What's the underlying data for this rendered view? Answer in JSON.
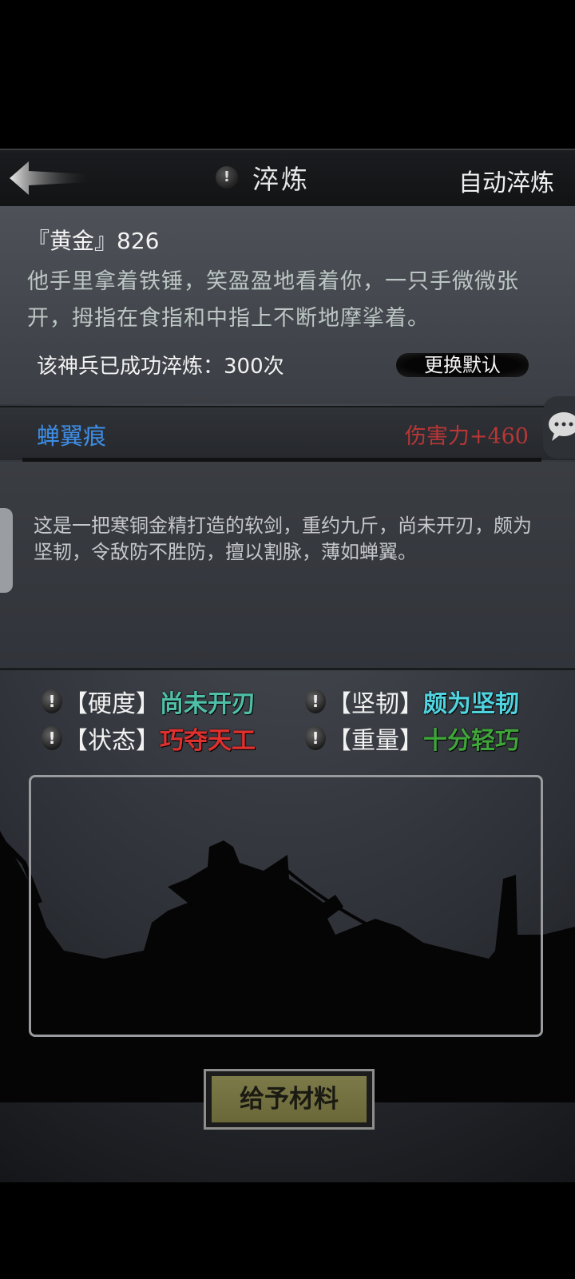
{
  "header": {
    "title": "淬炼",
    "info_icon": "!",
    "auto_label": "自动淬炼",
    "back_icon": "arrow-left-icon"
  },
  "item": {
    "name": "『黄金』826",
    "description": "他手里拿着铁锤，笑盈盈地看着你，一只手微微张开，拇指在食指和中指上不断地摩挲着。",
    "count_text": "该神兵已成功淬炼：300次",
    "default_button": "更换默认"
  },
  "weapon": {
    "name": "蝉翼痕",
    "damage": "伤害力+460",
    "lore": "这是一把寒铜金精打造的软剑，重约九斤，尚未开刃，颇为坚韧，令敌防不胜防，擅以割脉，薄如蝉翼。"
  },
  "stats": [
    {
      "label": "【硬度】",
      "value": "尚未开刃",
      "color": "#4fbfa8"
    },
    {
      "label": "【坚韧】",
      "value": "颇为坚韧",
      "color": "#4fd4e0"
    },
    {
      "label": "【状态】",
      "value": "巧夺天工",
      "color": "#e0302e"
    },
    {
      "label": "【重量】",
      "value": "十分轻巧",
      "color": "#3fa43a"
    }
  ],
  "stat_icon": "!",
  "give_button": "给予材料",
  "colors": {
    "weapon_name": "#3d8ee6",
    "damage": "#b83636",
    "give_button_bg": "#7d7a4a"
  }
}
